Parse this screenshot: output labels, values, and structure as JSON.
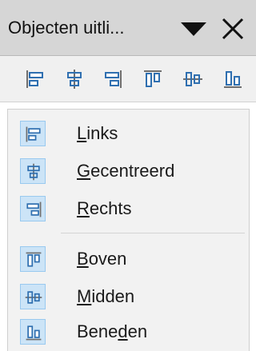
{
  "window": {
    "title": "Objecten uitli...",
    "dropdown_icon": "triangle-down-icon",
    "close_icon": "close-icon"
  },
  "toolbar": {
    "buttons": [
      {
        "name": "align-left",
        "icon": "align-left-icon"
      },
      {
        "name": "align-center",
        "icon": "align-center-icon"
      },
      {
        "name": "align-right",
        "icon": "align-right-icon"
      },
      {
        "name": "align-top",
        "icon": "align-top-icon"
      },
      {
        "name": "align-middle",
        "icon": "align-middle-icon"
      },
      {
        "name": "align-bottom",
        "icon": "align-bottom-icon"
      }
    ]
  },
  "menu": {
    "items": [
      {
        "label": "Links",
        "mnemonic": "L",
        "icon": "align-left-icon"
      },
      {
        "label": "Gecentreerd",
        "mnemonic": "G",
        "icon": "align-center-icon"
      },
      {
        "label": "Rechts",
        "mnemonic": "R",
        "icon": "align-right-icon"
      },
      {
        "label": "Boven",
        "mnemonic": "B",
        "icon": "align-top-icon"
      },
      {
        "label": "Midden",
        "mnemonic": "M",
        "icon": "align-middle-icon"
      },
      {
        "label": "Beneden",
        "mnemonic": "d",
        "icon": "align-bottom-icon"
      }
    ]
  },
  "colors": {
    "titlebar_bg": "#d6d6d6",
    "icon_blue": "#2f6fb0",
    "icon_gray": "#6e6e6e",
    "icon_highlight_bg": "#cce4f7",
    "menu_bg": "#f2f2f2"
  }
}
